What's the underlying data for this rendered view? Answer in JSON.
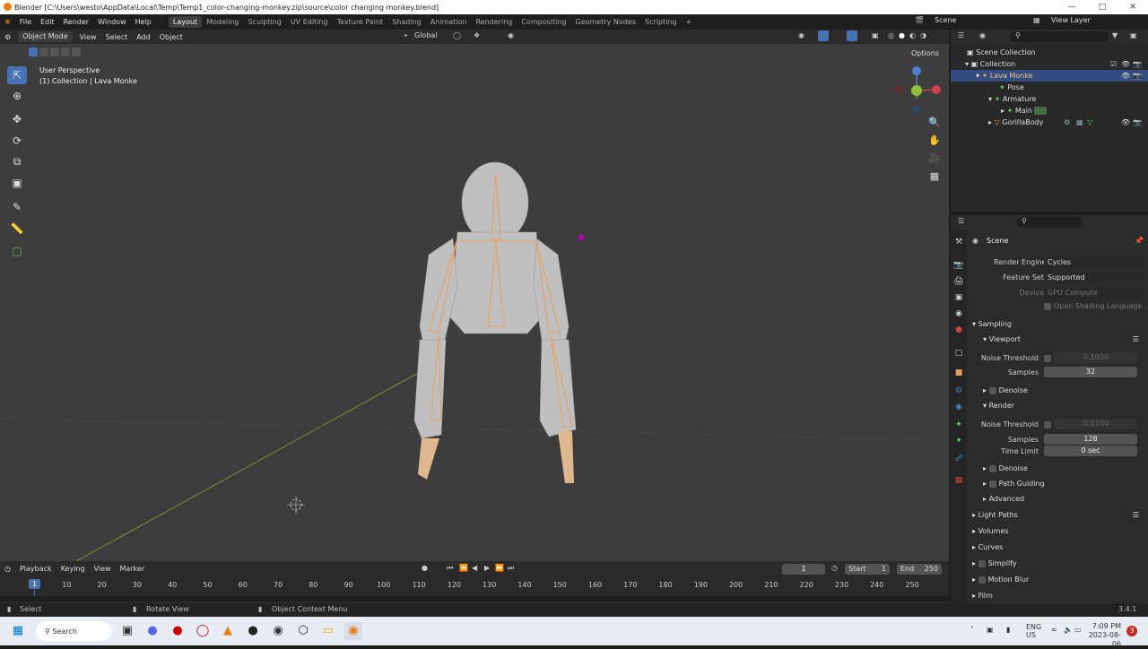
{
  "window": {
    "title": "Blender [C:\\Users\\westo\\AppData\\Local\\Temp\\Temp1_color-changing-monkey.zip\\source\\color changing monkey.blend]"
  },
  "menu": [
    "File",
    "Edit",
    "Render",
    "Window",
    "Help"
  ],
  "workspaces": [
    "Layout",
    "Modeling",
    "Sculpting",
    "UV Editing",
    "Texture Paint",
    "Shading",
    "Animation",
    "Rendering",
    "Compositing",
    "Geometry Nodes",
    "Scripting"
  ],
  "scene_label": "Scene",
  "viewlayer_label": "View Layer",
  "viewport": {
    "mode": "Object Mode",
    "menus": [
      "View",
      "Select",
      "Add",
      "Object"
    ],
    "orientation": "Global",
    "options": "Options",
    "info_line1": "User Perspective",
    "info_line2": "(1) Collection | Lava Monke"
  },
  "outliner": {
    "items": [
      {
        "label": "Scene Collection"
      },
      {
        "label": "Collection"
      },
      {
        "label": "Lava Monke"
      },
      {
        "label": "Pose"
      },
      {
        "label": "Armature"
      },
      {
        "label": "Main"
      },
      {
        "label": "GorillaBody"
      }
    ]
  },
  "properties": {
    "scene": "Scene",
    "render_engine_label": "Render Engine",
    "render_engine": "Cycles",
    "feature_set_label": "Feature Set",
    "feature_set": "Supported",
    "device_label": "Device",
    "device": "GPU Compute",
    "osl": "Open Shading Language",
    "sampling": "Sampling",
    "viewport": "Viewport",
    "noise_threshold_label": "Noise Threshold",
    "viewport_noise": "0.1000",
    "samples_label": "Samples",
    "viewport_samples": "32",
    "denoise": "Denoise",
    "render": "Render",
    "render_noise": "0.0100",
    "render_samples": "128",
    "time_limit_label": "Time Limit",
    "time_limit": "0 sec",
    "path_guiding": "Path Guiding",
    "advanced": "Advanced",
    "light_paths": "Light Paths",
    "volumes": "Volumes",
    "curves": "Curves",
    "simplify": "Simplify",
    "motion_blur": "Motion Blur",
    "film": "Film"
  },
  "timeline": {
    "menus": [
      "Playback",
      "Keying",
      "View",
      "Marker"
    ],
    "current_frame": "1",
    "start_label": "Start",
    "start": "1",
    "end_label": "End",
    "end": "250",
    "ticks": [
      "1",
      "10",
      "20",
      "30",
      "40",
      "50",
      "60",
      "70",
      "80",
      "90",
      "100",
      "110",
      "120",
      "130",
      "140",
      "150",
      "160",
      "170",
      "180",
      "190",
      "200",
      "210",
      "220",
      "230",
      "240",
      "250"
    ]
  },
  "status": {
    "select": "Select",
    "rotate": "Rotate View",
    "context": "Object Context Menu",
    "version": "3.4.1"
  },
  "taskbar": {
    "search": "Search",
    "lang1": "ENG",
    "lang2": "US",
    "time": "7:09 PM",
    "date": "2023-08-06",
    "notif": "3"
  },
  "colors": {
    "accent": "#4772b3",
    "selection": "#334d80",
    "bone": "#e8a060"
  }
}
